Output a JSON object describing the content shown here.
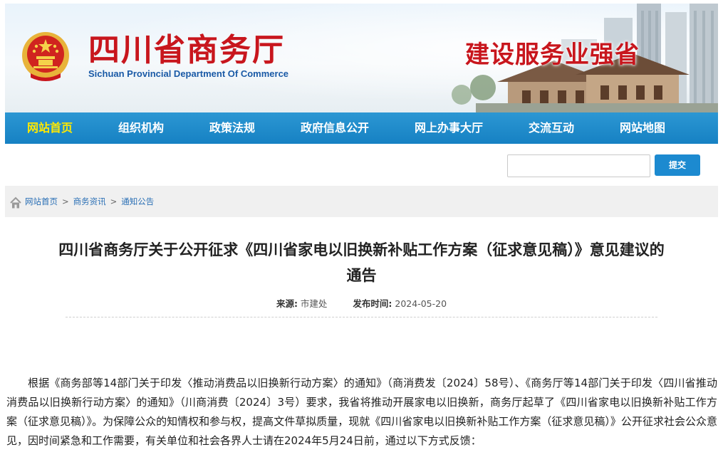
{
  "header": {
    "title_cn": "四川省商务厅",
    "title_en": "Sichuan Provincial Department Of Commerce",
    "slogan": "建设服务业强省"
  },
  "nav": {
    "items": [
      {
        "label": "网站首页",
        "active": true
      },
      {
        "label": "组织机构",
        "active": false
      },
      {
        "label": "政策法规",
        "active": false
      },
      {
        "label": "政府信息公开",
        "active": false
      },
      {
        "label": "网上办事大厅",
        "active": false
      },
      {
        "label": "交流互动",
        "active": false
      },
      {
        "label": "网站地图",
        "active": false
      }
    ]
  },
  "search": {
    "value": "",
    "button_label": "提交"
  },
  "breadcrumb": {
    "items": [
      "网站首页",
      "商务资讯",
      "通知公告"
    ],
    "separator": ">"
  },
  "article": {
    "title_line1": "四川省商务厅关于公开征求《四川省家电以旧换新补贴工作方案（征求意见稿）》意见建议的",
    "title_line2": "通告",
    "source_label": "来源:",
    "source_value": "市建处",
    "date_label": "发布时间:",
    "date_value": "2024-05-20",
    "body": "根据《商务部等14部门关于印发〈推动消费品以旧换新行动方案〉的通知》（商消费发〔2024〕58号）、《商务厅等14部门关于印发〈四川省推动消费品以旧换新行动方案〉的通知》（川商消费〔2024〕3号）要求，我省将推动开展家电以旧换新，商务厅起草了《四川省家电以旧换新补贴工作方案（征求意见稿）》。为保障公众的知情权和参与权，提高文件草拟质量，现就《四川省家电以旧换新补贴工作方案（征求意见稿）》公开征求社会公众意见，因时间紧急和工作需要，有关单位和社会各界人士请在2024年5月24日前，通过以下方式反馈："
  },
  "colors": {
    "brand_red": "#c8161d",
    "nav_blue": "#1681c3",
    "nav_active": "#ffe900",
    "link_blue": "#2a6fb5"
  }
}
